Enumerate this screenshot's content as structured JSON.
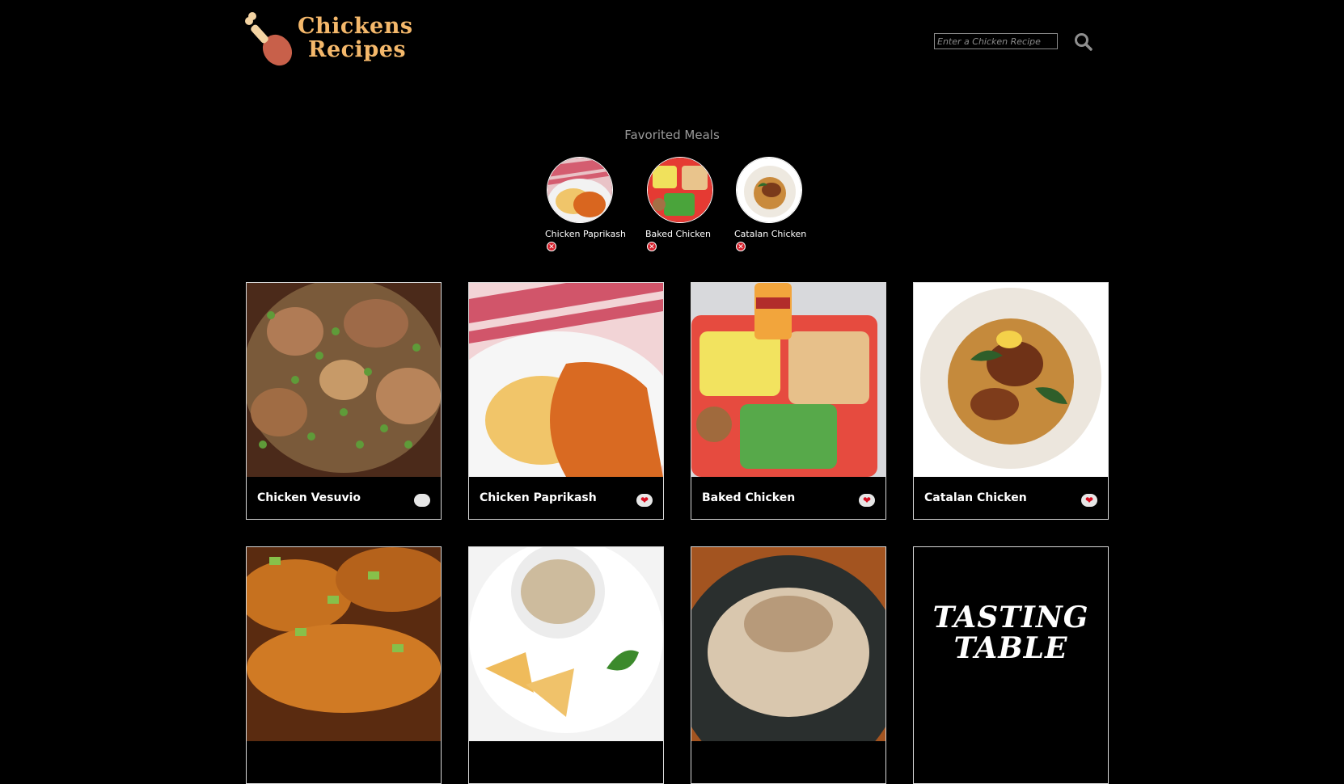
{
  "header": {
    "logo_line1": "Chickens",
    "logo_line2": "Recipes",
    "search_placeholder": "Enter a Chicken Recipe",
    "search_icon": "magnifier-icon"
  },
  "favorites": {
    "title": "Favorited Meals",
    "items": [
      {
        "name": "Chicken Paprikash",
        "remove_icon": "close-circle-icon"
      },
      {
        "name": "Baked Chicken",
        "remove_icon": "close-circle-icon"
      },
      {
        "name": "Catalan Chicken",
        "remove_icon": "close-circle-icon"
      }
    ]
  },
  "meals": [
    {
      "name": "Chicken Vesuvio",
      "favorited": false
    },
    {
      "name": "Chicken Paprikash",
      "favorited": true
    },
    {
      "name": "Baked Chicken",
      "favorited": true
    },
    {
      "name": "Catalan Chicken",
      "favorited": true
    },
    {
      "name": "",
      "favorited": false
    },
    {
      "name": "",
      "favorited": false
    },
    {
      "name": "",
      "favorited": false
    },
    {
      "name": "",
      "favorited": false,
      "logo_line1": "TASTING",
      "logo_line2": "TABLE"
    }
  ],
  "colors": {
    "background": "#000000",
    "logo": "#f4b86b",
    "heart": "#d80d20"
  }
}
